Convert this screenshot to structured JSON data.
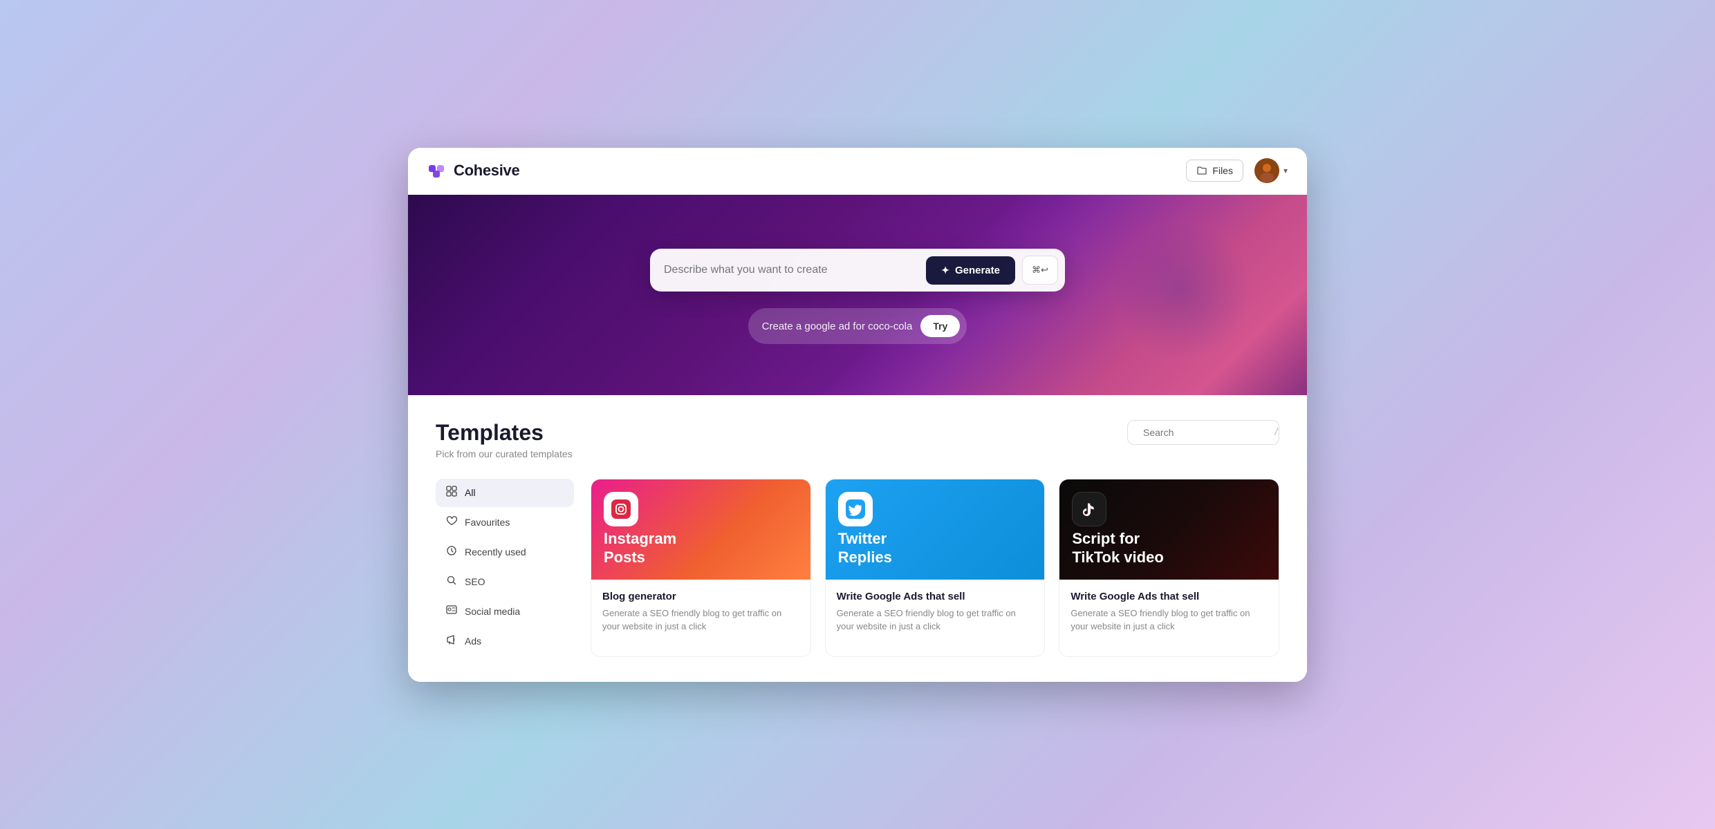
{
  "app": {
    "name": "Cohesive",
    "logo_alt": "cohesive-logo"
  },
  "header": {
    "files_label": "Files",
    "user_chevron": "chevron"
  },
  "hero": {
    "search_placeholder": "Describe what you want to create",
    "generate_label": "Generate",
    "keyboard_shortcut": "⌘↩",
    "suggestion_text": "Create a google ad for coco-cola",
    "try_label": "Try"
  },
  "templates_section": {
    "title": "Templates",
    "subtitle": "Pick from our curated templates",
    "search_placeholder": "Search"
  },
  "sidebar": {
    "items": [
      {
        "id": "all",
        "label": "All",
        "icon": "⊞",
        "active": true
      },
      {
        "id": "favourites",
        "label": "Favourites",
        "icon": "♡",
        "active": false
      },
      {
        "id": "recently-used",
        "label": "Recently used",
        "icon": "◎",
        "active": false
      },
      {
        "id": "seo",
        "label": "SEO",
        "icon": "🔍",
        "active": false
      },
      {
        "id": "social-media",
        "label": "Social media",
        "icon": "👤",
        "active": false
      },
      {
        "id": "ads",
        "label": "Ads",
        "icon": "📣",
        "active": false
      }
    ]
  },
  "templates": [
    {
      "id": "instagram",
      "banner_type": "instagram",
      "platform_icon": "📷",
      "title": "Instagram\nPosts",
      "subtitle": "Blog generator",
      "description": "Generate a SEO friendly blog to get traffic on your website in just a click"
    },
    {
      "id": "twitter",
      "banner_type": "twitter",
      "platform_icon": "🐦",
      "title": "Twitter\nReplies",
      "subtitle": "Write Google Ads that sell",
      "description": "Generate a SEO friendly blog to get traffic on your website in just a click"
    },
    {
      "id": "tiktok",
      "banner_type": "tiktok",
      "platform_icon": "♪",
      "title": "Script for\nTikTok video",
      "subtitle": "Write Google Ads that sell",
      "description": "Generate a SEO friendly blog to get traffic on your website in just a click"
    }
  ]
}
